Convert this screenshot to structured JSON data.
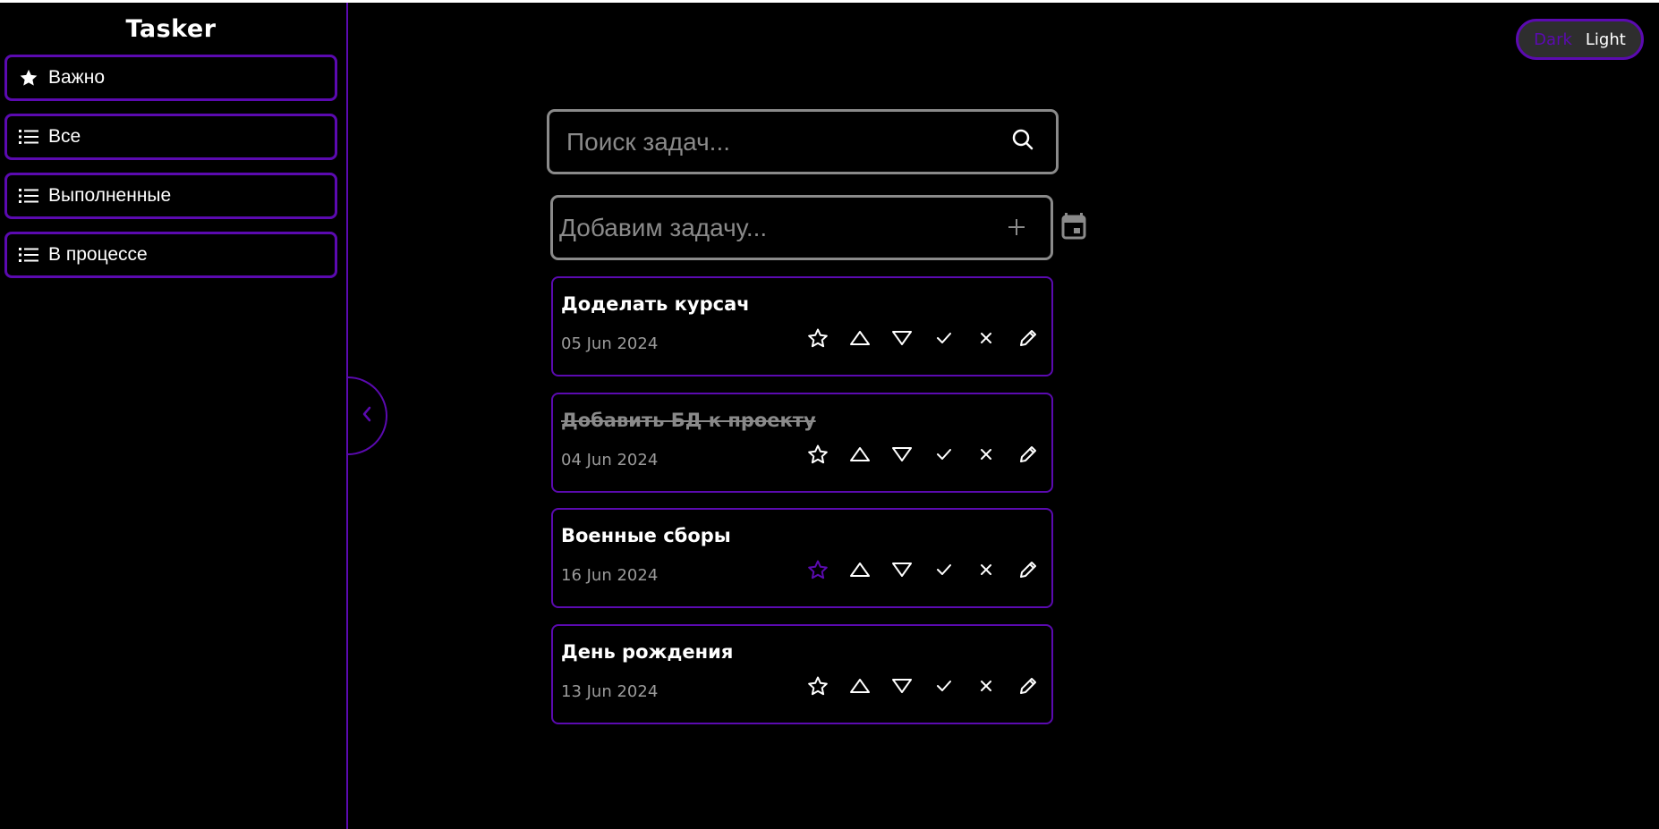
{
  "app": {
    "title": "Tasker"
  },
  "sidebar": {
    "items": [
      {
        "label": "Важно",
        "icon": "star-icon"
      },
      {
        "label": "Все",
        "icon": "list-icon"
      },
      {
        "label": "Выполненные",
        "icon": "list-icon"
      },
      {
        "label": "В процессе",
        "icon": "list-icon"
      }
    ]
  },
  "theme": {
    "dark_label": "Dark",
    "light_label": "Light",
    "active": "Dark"
  },
  "search": {
    "placeholder": "Поиск задач..."
  },
  "add": {
    "placeholder": "Добавим задачу..."
  },
  "tasks": [
    {
      "title": "Доделать курсач",
      "date": "05 Jun 2024",
      "done": false,
      "important": false
    },
    {
      "title": "Добавить БД к проекту",
      "date": "04 Jun 2024",
      "done": true,
      "important": false
    },
    {
      "title": "Военные сборы",
      "date": "16 Jun 2024",
      "done": false,
      "important": true
    },
    {
      "title": "День рождения",
      "date": "13 Jun 2024",
      "done": false,
      "important": false
    }
  ],
  "colors": {
    "accent": "#5b0ab0",
    "background": "#000000",
    "muted": "#8a8a8a",
    "text": "#ffffff"
  }
}
